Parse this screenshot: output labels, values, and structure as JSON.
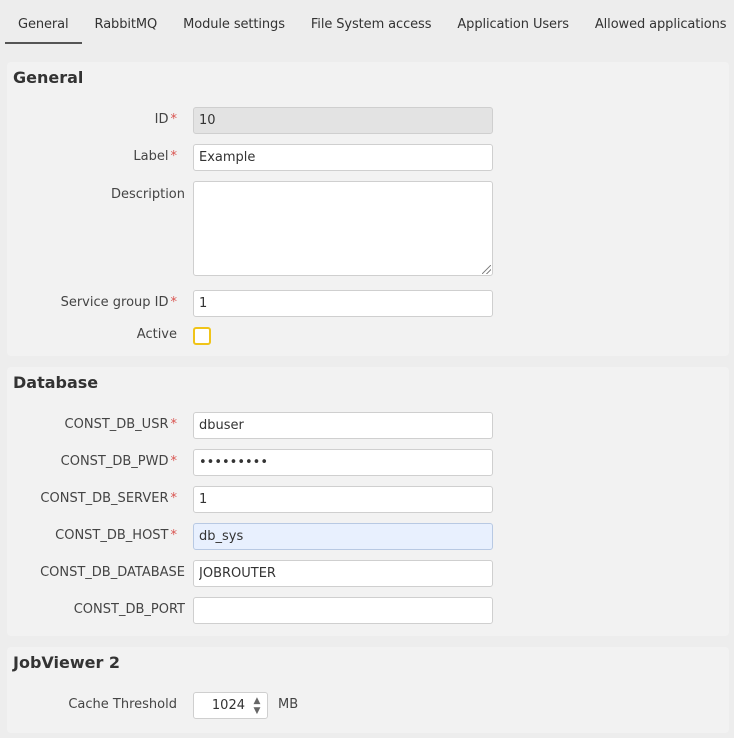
{
  "tabs": [
    {
      "label": "General",
      "active": true
    },
    {
      "label": "RabbitMQ",
      "active": false
    },
    {
      "label": "Module settings",
      "active": false
    },
    {
      "label": "File System access",
      "active": false
    },
    {
      "label": "Application Users",
      "active": false
    },
    {
      "label": "Allowed applications",
      "active": false
    }
  ],
  "general": {
    "title": "General",
    "id_label": "ID",
    "id_value": "10",
    "label_label": "Label",
    "label_value": "Example",
    "description_label": "Description",
    "description_value": "",
    "service_group_label": "Service group ID",
    "service_group_value": "1",
    "active_label": "Active",
    "active_checked": false
  },
  "database": {
    "title": "Database",
    "usr_label": "CONST_DB_USR",
    "usr_value": "dbuser",
    "pwd_label": "CONST_DB_PWD",
    "pwd_value": "•••••••••",
    "server_label": "CONST_DB_SERVER",
    "server_value": "1",
    "host_label": "CONST_DB_HOST",
    "host_value": "db_sys",
    "database_label": "CONST_DB_DATABASE",
    "database_value": "JOBROUTER",
    "port_label": "CONST_DB_PORT",
    "port_value": ""
  },
  "jobviewer": {
    "title": "JobViewer 2",
    "cache_label": "Cache Threshold",
    "cache_value": "1024",
    "cache_unit": "MB"
  },
  "required_marker": "*",
  "colors": {
    "required": "#d9534f",
    "checkbox_border": "#f0c419",
    "focused_field": "#e8f0fe"
  }
}
